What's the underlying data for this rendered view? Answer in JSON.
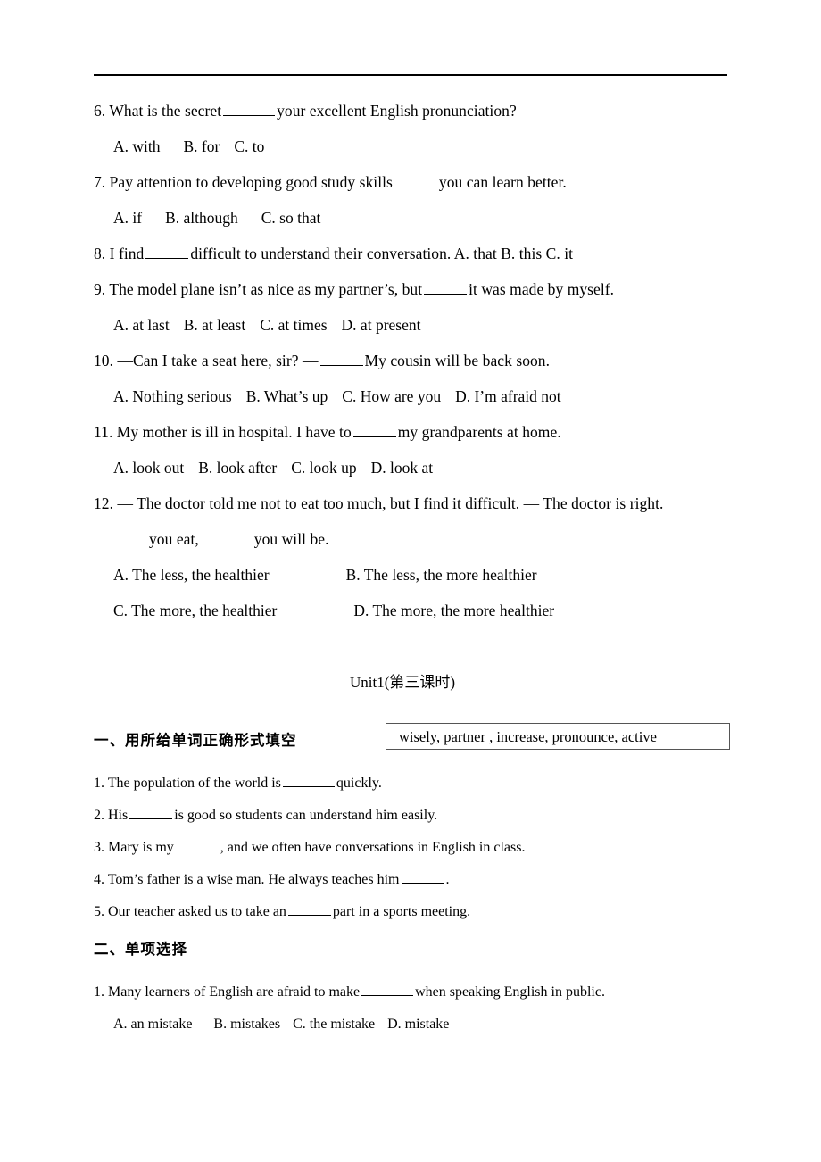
{
  "document": {
    "type": "worksheet",
    "horizontal_rule": true
  },
  "section_top": {
    "questions": [
      {
        "stem_before": "6. What is the secret",
        "stem_after": "your excellent English pronunciation?",
        "blank": "medium",
        "options": [
          "A. with",
          "B. for",
          "C. to"
        ]
      },
      {
        "stem_before": "7. Pay attention to developing good study skills",
        "stem_after": "you can learn better.",
        "blank": "medium",
        "options": [
          "A. if",
          "B. although",
          "C. so that"
        ]
      },
      {
        "stem_before": "8. I find",
        "stem_after": "difficult to understand their conversation. A. that   B. this   C. it",
        "blank": "medium",
        "options": []
      },
      {
        "stem_before": "9. The model plane isn’t as nice as my partner’s, but",
        "stem_after": "it was made by myself.",
        "blank": "medium",
        "options": [
          "A. at last",
          "B. at least",
          "C. at times",
          "D. at present"
        ]
      },
      {
        "stem_before": "10. —Can I take a seat here, sir?  —",
        "stem_after": "My cousin will be back soon.",
        "blank": "medium",
        "options": [
          "A. Nothing serious",
          "B. What’s up",
          "C. How are you",
          "D. I’m afraid not"
        ]
      },
      {
        "stem_before": "11. My mother is ill in hospital. I have to",
        "stem_after": "my grandparents at home.",
        "blank": "medium",
        "options": [
          "A. look out",
          "B. look after",
          "C. look up",
          "D. look at"
        ]
      }
    ],
    "question12": {
      "line1": "12. — The doctor told me not to eat too much, but I find it difficult. — The doctor is right.",
      "line2_mid": "you eat,",
      "line2_end": "you will be.",
      "options_row1": [
        "A. The less, the healthier",
        "B. The less, the more healthier"
      ],
      "options_row2": [
        "C. The more, the healthier",
        "D. The more, the more healthier"
      ]
    }
  },
  "unit": {
    "title": "Unit1(第三课时)"
  },
  "section_one": {
    "heading": "一、用所给单词正确形式填空",
    "word_bank": "wisely,   partner , increase, pronounce,  active",
    "items": [
      {
        "before": "1. The population of the world is",
        "after": "quickly."
      },
      {
        "before": "2. His",
        "after": "is good so students can understand him easily."
      },
      {
        "before": "3. Mary is my",
        "after": ", and we often have conversations in English in class."
      },
      {
        "before": "4. Tom’s father is a wise man. He always teaches him",
        "after": "."
      },
      {
        "before": "5. Our teacher  asked us to take an",
        "after": "part in a sports meeting."
      }
    ]
  },
  "section_two": {
    "heading": "二、单项选择",
    "questions": [
      {
        "stem_before": "1. Many learners of English are afraid to make",
        "stem_after": "when speaking English in public.",
        "options": [
          "A. an mistake",
          "B. mistakes",
          "C. the mistake",
          "D. mistake"
        ]
      }
    ]
  }
}
